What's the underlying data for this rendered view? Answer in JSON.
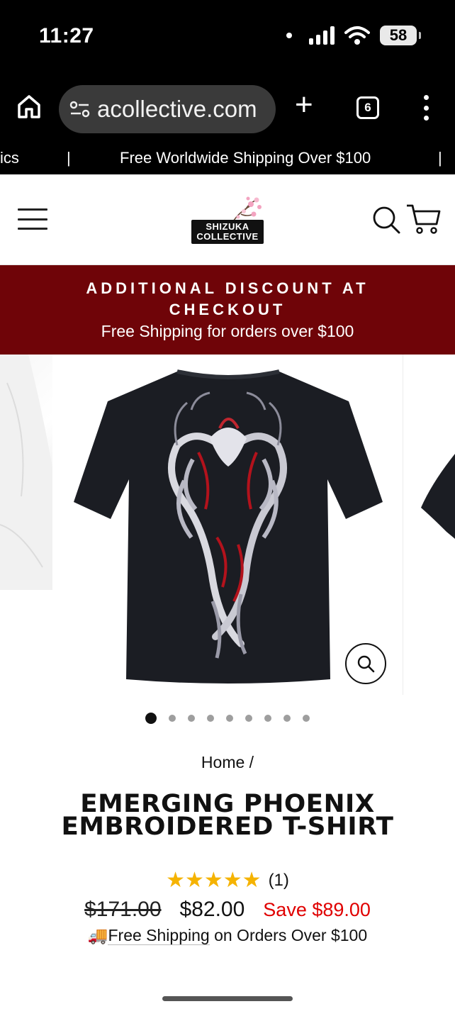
{
  "status_bar": {
    "time": "11:27",
    "battery": "58"
  },
  "browser": {
    "url": "acollective.com",
    "new_tab": "+",
    "tab_count": "6"
  },
  "announcement": {
    "left_fragment": "ics",
    "separator": "|",
    "message": "Free Worldwide Shipping Over $100"
  },
  "header": {
    "logo_line1": "SHIZUKA",
    "logo_line2": "COLLECTIVE"
  },
  "promo": {
    "title": "ADDITIONAL DISCOUNT AT CHECKOUT",
    "subtitle": "Free Shipping for orders over $100"
  },
  "gallery": {
    "dot_count": 9,
    "active_index": 0
  },
  "breadcrumb": "Home /",
  "product": {
    "title": "EMERGING PHOENIX EMBROIDERED T-SHIRT",
    "stars": "★★★★★",
    "rating_value": 5,
    "review_count": "(1)",
    "compare_price": "$171.00",
    "price": "$82.00",
    "savings": "Save $89.00",
    "shipping_emoji": "🚚",
    "shipping_note": "Free Shipping",
    "shipping_note_rest": " on Orders Over $100"
  },
  "colors": {
    "promo_bg": "#6f0408",
    "save_red": "#e00000",
    "star": "#f5b301"
  }
}
